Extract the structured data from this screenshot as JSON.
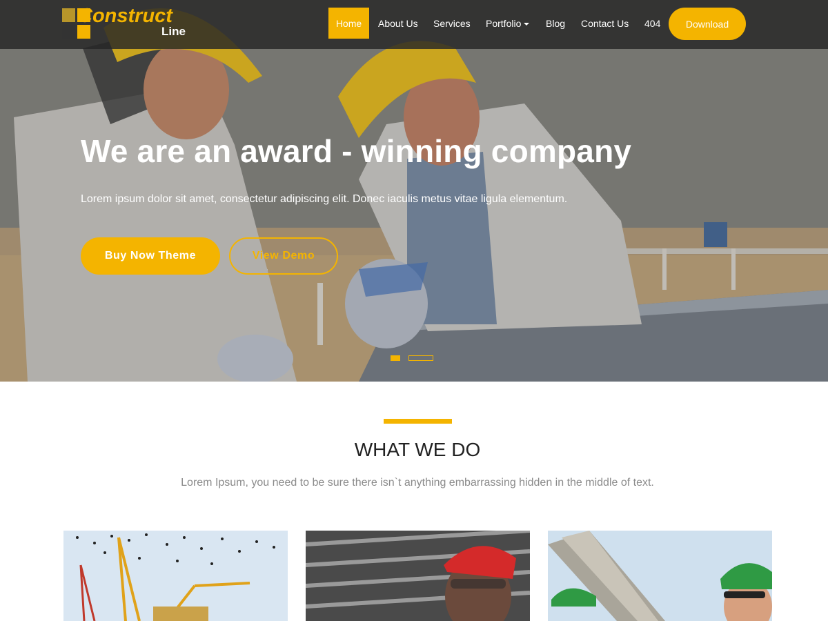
{
  "brand": {
    "logo_title": "Construct",
    "logo_sub": "Line"
  },
  "nav": {
    "items": [
      "Home",
      "About Us",
      "Services",
      "Portfolio",
      "Blog",
      "Contact Us",
      "404"
    ],
    "active": "Home",
    "download_label": "Download"
  },
  "hero": {
    "title": "We are an award - winning company",
    "subtitle": "Lorem ipsum dolor sit amet, consectetur adipiscing elit. Donec iaculis metus vitae ligula elementum.",
    "buy_label": "Buy Now Theme",
    "demo_label": "View Demo",
    "slides": {
      "count": 2,
      "active": 1
    }
  },
  "section": {
    "title": "WHAT WE DO",
    "subtitle": "Lorem Ipsum, you need to be sure there isn`t anything embarrassing hidden in the middle of text."
  },
  "colors": {
    "accent": "#f4b400",
    "header_bg": "#262626",
    "text_dark": "#222222",
    "text_muted": "#8a8a8a"
  },
  "icons": [
    "logo-mark-icon",
    "dropdown-caret-icon"
  ]
}
